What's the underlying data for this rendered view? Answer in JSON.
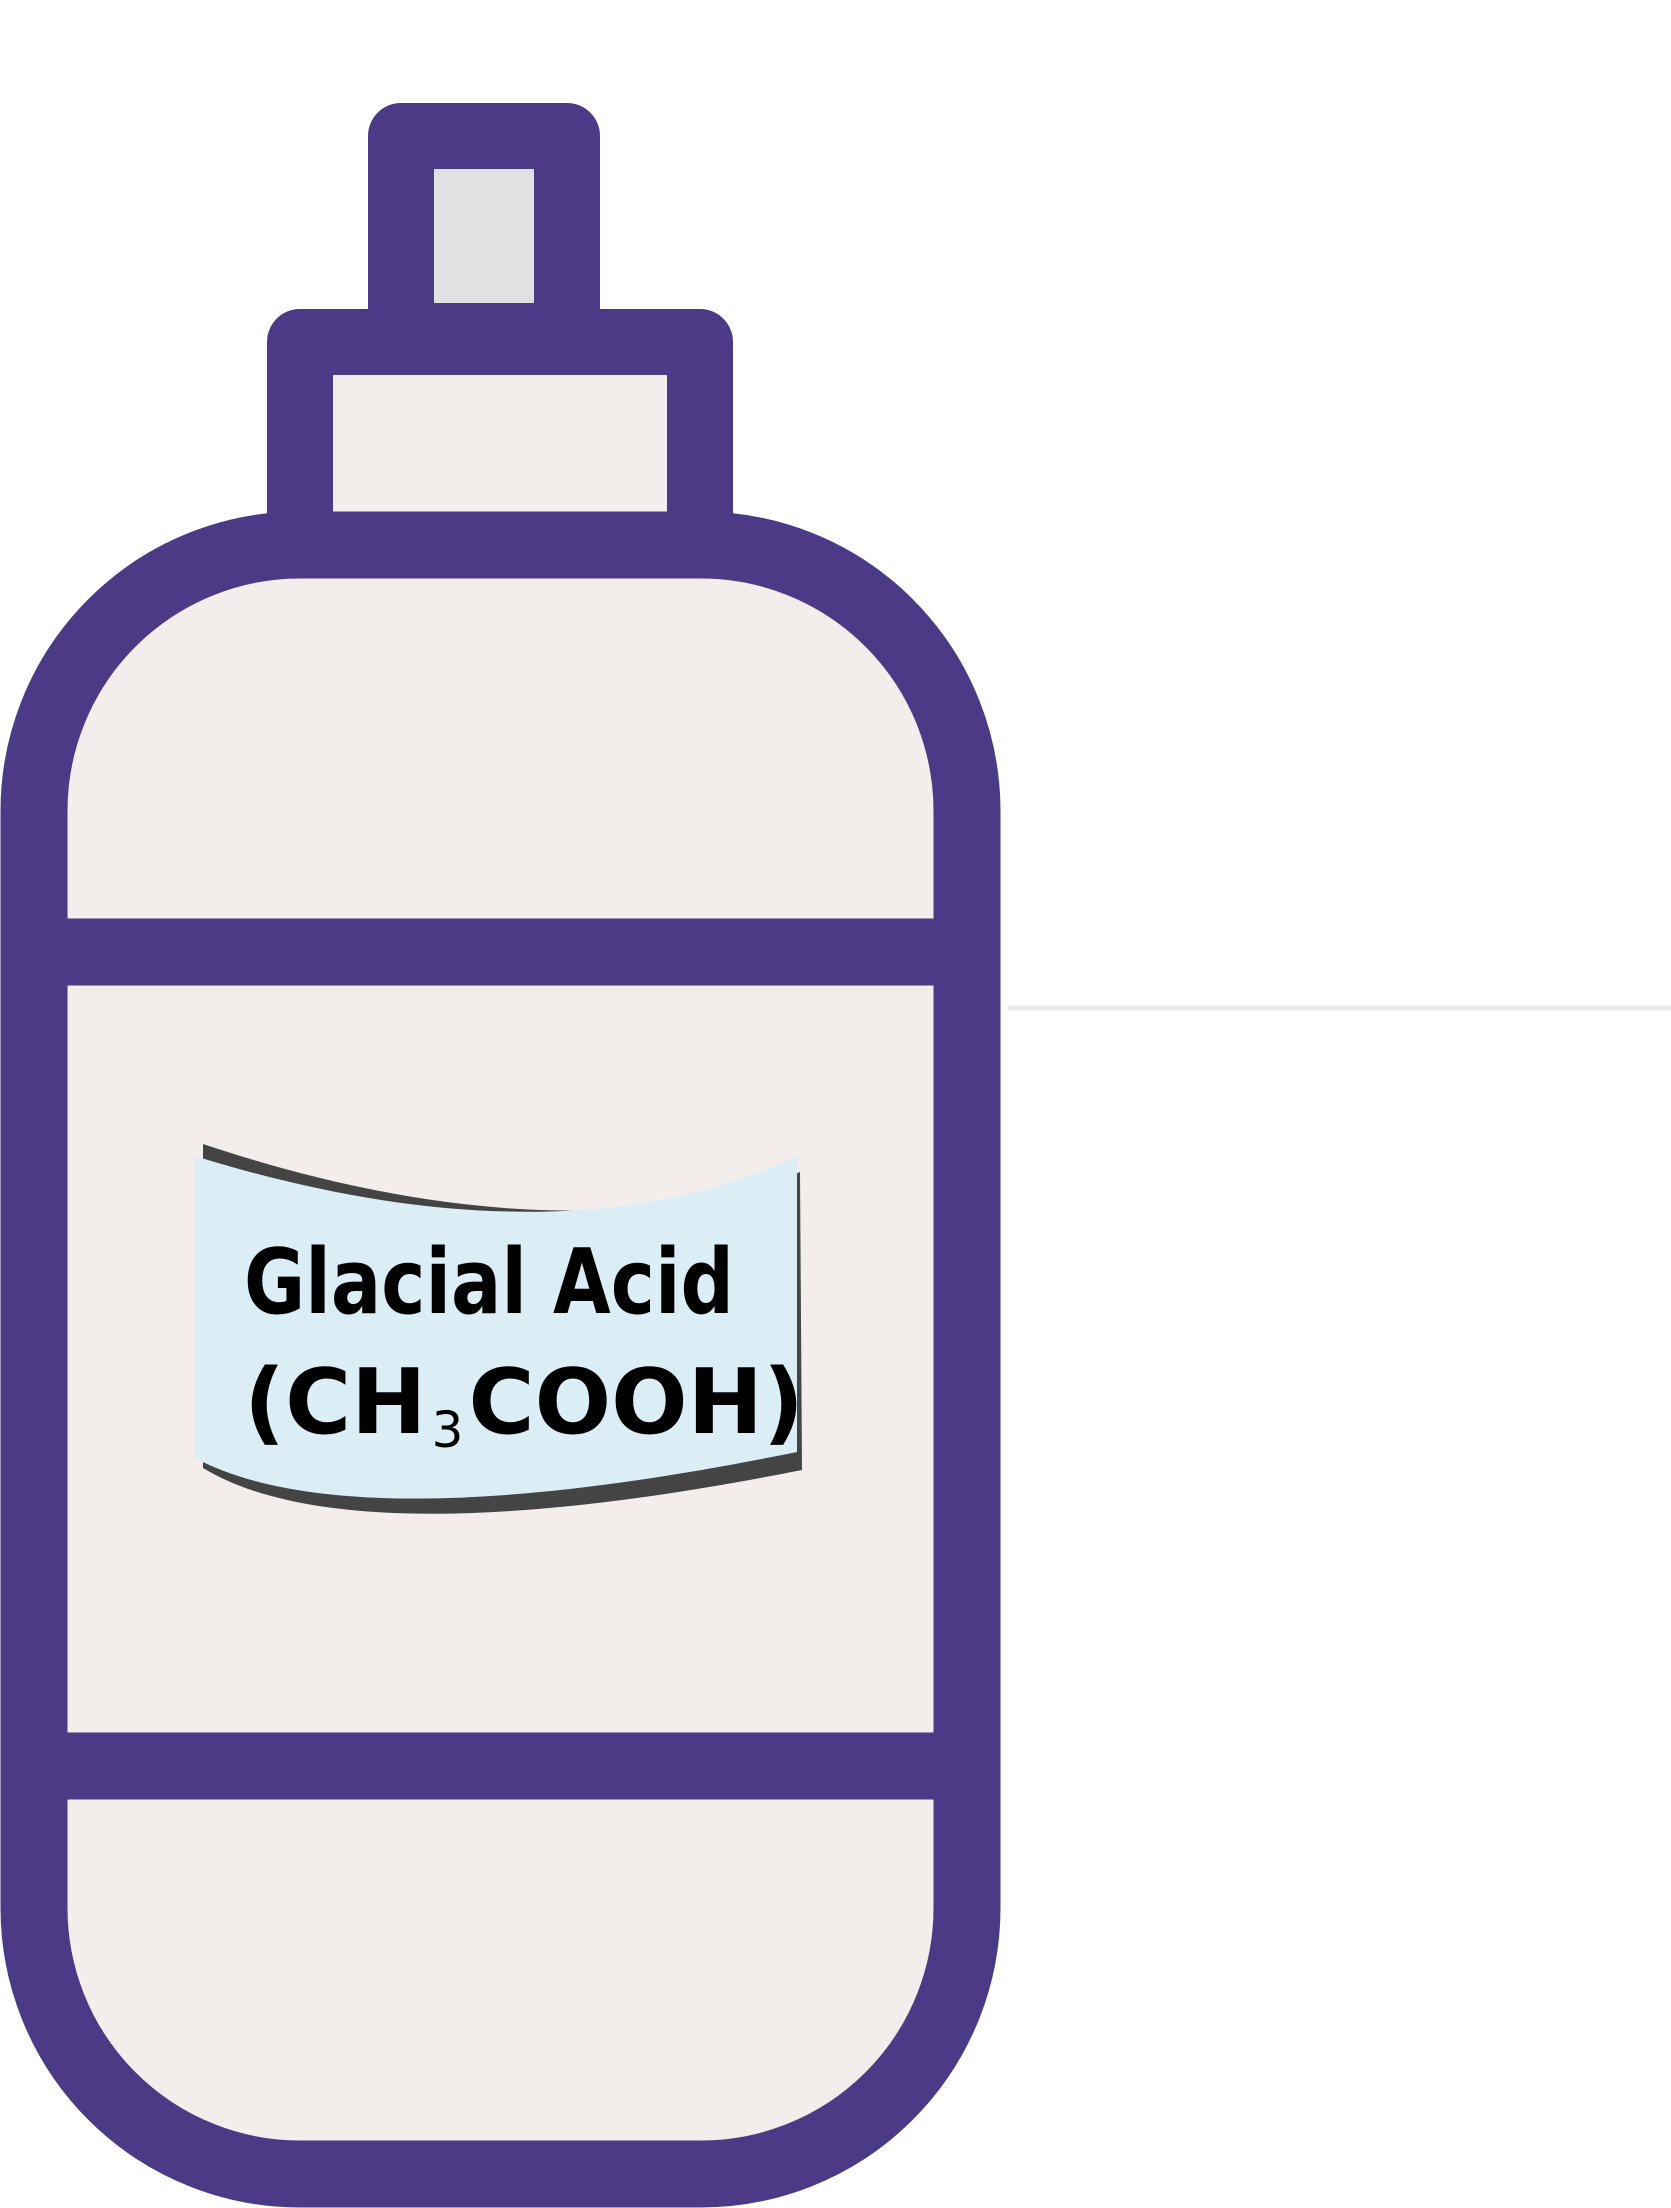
{
  "illustration": {
    "subject": "bottle",
    "label": {
      "line1": "Glacial Acid",
      "line2_open": "(CH",
      "line2_subscript": "3",
      "line2_close": "COOH)"
    }
  },
  "colors": {
    "outline": "#4b3a85",
    "body_fill": "#f3eeec",
    "cap_fill": "#e1e1e4",
    "label_fill": "#dbeef5",
    "label_shadow": "#444444",
    "divider": "#ececec",
    "text": "#000000"
  }
}
